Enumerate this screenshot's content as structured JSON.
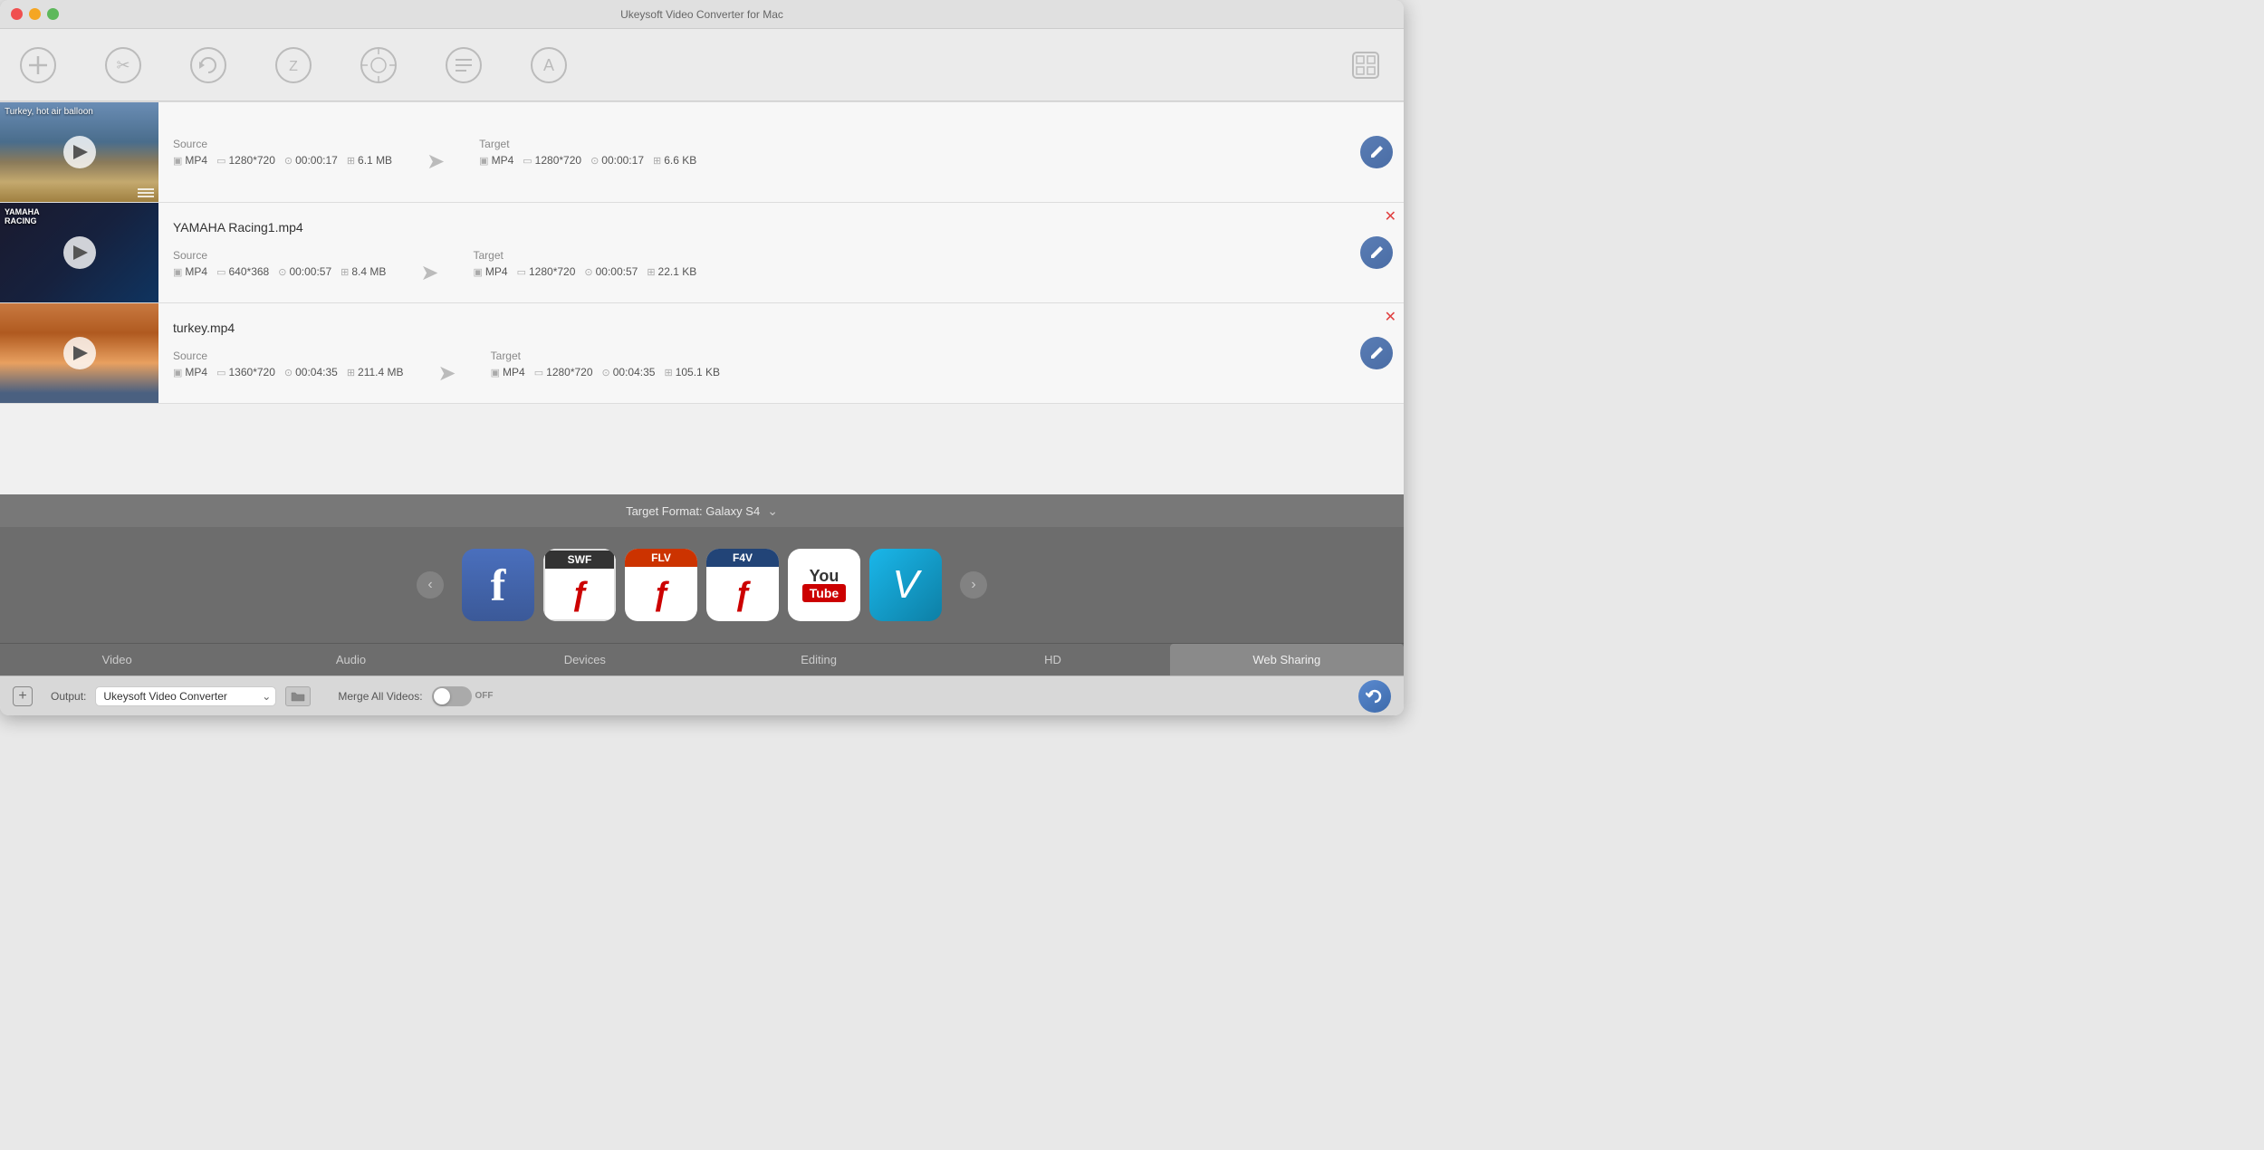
{
  "app": {
    "title": "Ukeysoft Video Converter for Mac"
  },
  "toolbar": {
    "icons": [
      {
        "name": "add-icon",
        "symbol": "+"
      },
      {
        "name": "convert-icon",
        "symbol": "✂"
      },
      {
        "name": "refresh-icon",
        "symbol": "↻"
      },
      {
        "name": "zip-icon",
        "symbol": "Z"
      },
      {
        "name": "magic-icon",
        "symbol": "✦"
      },
      {
        "name": "edit-icon",
        "symbol": "☰"
      },
      {
        "name": "text-icon",
        "symbol": "A"
      }
    ],
    "settings_icon": "⚙"
  },
  "videos": [
    {
      "id": "v1",
      "filename": "Turkey, hot air balloon",
      "thumbnail_type": "turkey-balloon",
      "show_close": false,
      "source": {
        "format": "MP4",
        "resolution": "1280*720",
        "duration": "00:00:17",
        "size": "6.1 MB"
      },
      "target": {
        "format": "MP4",
        "resolution": "1280*720",
        "duration": "00:00:17",
        "size": "6.6 KB"
      }
    },
    {
      "id": "v2",
      "filename": "YAMAHA Racing1.mp4",
      "thumbnail_type": "yamaha",
      "show_close": true,
      "source": {
        "format": "MP4",
        "resolution": "640*368",
        "duration": "00:00:57",
        "size": "8.4 MB"
      },
      "target": {
        "format": "MP4",
        "resolution": "1280*720",
        "duration": "00:00:57",
        "size": "22.1 KB"
      }
    },
    {
      "id": "v3",
      "filename": "turkey.mp4",
      "thumbnail_type": "turkey",
      "show_close": true,
      "source": {
        "format": "MP4",
        "resolution": "1360*720",
        "duration": "00:04:35",
        "size": "211.4 MB"
      },
      "target": {
        "format": "MP4",
        "resolution": "1280*720",
        "duration": "00:04:35",
        "size": "105.1 KB"
      }
    }
  ],
  "format_bar": {
    "label": "Target Format: Galaxy S4",
    "arrow": "⌄"
  },
  "format_icons": [
    {
      "name": "facebook",
      "label": "f",
      "type": "facebook"
    },
    {
      "name": "SWF",
      "label": "SWF",
      "type": "swf"
    },
    {
      "name": "FLV",
      "label": "FLV",
      "type": "flv"
    },
    {
      "name": "F4V",
      "label": "F4V",
      "type": "f4v"
    },
    {
      "name": "YouTube",
      "label": "YouTube",
      "type": "youtube"
    },
    {
      "name": "Vimeo",
      "label": "Vimeo",
      "type": "vimeo"
    }
  ],
  "tabs": [
    {
      "label": "Video",
      "active": false
    },
    {
      "label": "Audio",
      "active": false
    },
    {
      "label": "Devices",
      "active": false
    },
    {
      "label": "Editing",
      "active": false
    },
    {
      "label": "HD",
      "active": false
    },
    {
      "label": "Web Sharing",
      "active": true
    }
  ],
  "bottom_bar": {
    "output_label": "Output:",
    "output_value": "Ukeysoft Video Converter",
    "merge_label": "Merge All Videos:",
    "toggle_state": "OFF"
  }
}
